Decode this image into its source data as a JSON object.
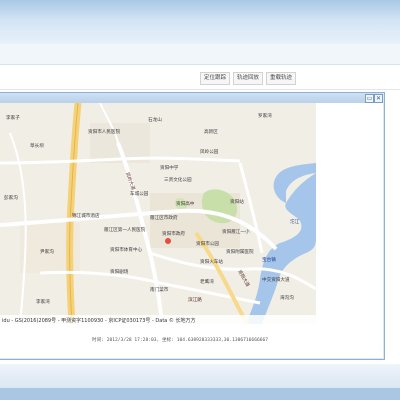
{
  "toolbar": {
    "buttons": [
      "定位跟踪",
      "轨迹回放",
      "重载轨迹"
    ]
  },
  "window": {
    "minimize_glyph": "▭",
    "close_glyph": "✕"
  },
  "map": {
    "labels": [
      {
        "text": "李家子",
        "kind": "place"
      },
      {
        "text": "资阳市人民医院",
        "kind": "place"
      },
      {
        "text": "高新区",
        "kind": "place"
      },
      {
        "text": "石龙山",
        "kind": "place"
      },
      {
        "text": "罗家湾",
        "kind": "place"
      },
      {
        "text": "草长坝",
        "kind": "place"
      },
      {
        "text": "凤岭公园",
        "kind": "place"
      },
      {
        "text": "资阳中学",
        "kind": "place"
      },
      {
        "text": "三贤文化公园",
        "kind": "place"
      },
      {
        "text": "车城公园",
        "kind": "place"
      },
      {
        "text": "资阳高中",
        "kind": "place"
      },
      {
        "text": "凤岭大道",
        "kind": "road"
      },
      {
        "text": "资阳站",
        "kind": "place"
      },
      {
        "text": "雁江区市政府",
        "kind": "place"
      },
      {
        "text": "锦江城市酒店",
        "kind": "place"
      },
      {
        "text": "雁江区第一人民医院",
        "kind": "place"
      },
      {
        "text": "资阳市体育中心",
        "kind": "place"
      },
      {
        "text": "资阳市政府",
        "kind": "place"
      },
      {
        "text": "资阳市公园",
        "kind": "place"
      },
      {
        "text": "资阳雁江一小",
        "kind": "place"
      },
      {
        "text": "资阳火车站",
        "kind": "place"
      },
      {
        "text": "资阳附属医院",
        "kind": "place"
      },
      {
        "text": "沱江",
        "kind": "water"
      },
      {
        "text": "宝台镇",
        "kind": "place"
      },
      {
        "text": "资阳大道",
        "kind": "road"
      },
      {
        "text": "资阳剧场",
        "kind": "place"
      },
      {
        "text": "南门菜市",
        "kind": "place"
      },
      {
        "text": "滨江路",
        "kind": "road"
      },
      {
        "text": "尹家沟",
        "kind": "place"
      },
      {
        "text": "彭家沟",
        "kind": "place"
      },
      {
        "text": "李家湾",
        "kind": "place"
      },
      {
        "text": "中交资阳大道",
        "kind": "road"
      },
      {
        "text": "海沟沟",
        "kind": "place"
      },
      {
        "text": "老鹰湾",
        "kind": "place"
      }
    ],
    "copyright": "idu - GS(2016)2089号 - 甲测资字1100930 - 京ICP证030173号 - Data © 长地万方"
  },
  "status": {
    "info_text": "时间: 2012/3/28 17:28:03, 坐标: 104.638928333333,30.1306716666667"
  }
}
